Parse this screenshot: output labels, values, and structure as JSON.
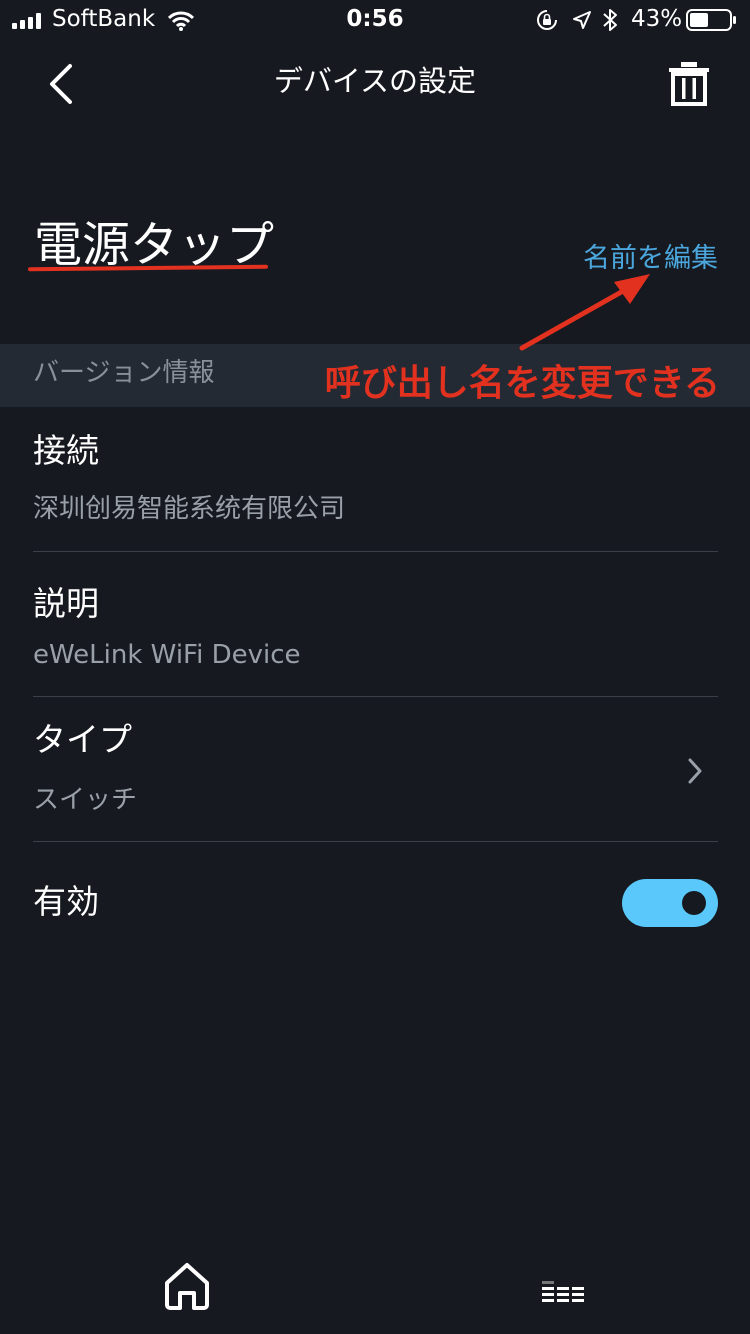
{
  "status_bar": {
    "carrier": "SoftBank",
    "time": "0:56",
    "battery": "43%"
  },
  "nav": {
    "title": "デバイスの設定"
  },
  "device": {
    "name": "電源タップ",
    "edit_label": "名前を編集"
  },
  "section": {
    "version_label": "バージョン情報"
  },
  "annotation": {
    "text": "呼び出し名を変更できる"
  },
  "rows": [
    {
      "title": "接続",
      "value": "深圳创易智能系统有限公司"
    },
    {
      "title": "説明",
      "value": "eWeLink WiFi Device"
    },
    {
      "title": "タイプ",
      "value": "スイッチ"
    },
    {
      "title": "有効"
    }
  ],
  "toggle": {
    "enabled": true
  },
  "colors": {
    "background": "#161a20",
    "accent": "#4aa6dc",
    "toggle_on": "#5ac8fa",
    "annotation": "#e3311f"
  },
  "icons": [
    "signal-icon",
    "wifi-icon",
    "orientation-lock-icon",
    "location-icon",
    "bluetooth-icon",
    "battery-icon",
    "back-chevron-icon",
    "trash-icon",
    "chevron-right-icon",
    "home-icon",
    "devices-list-icon"
  ]
}
